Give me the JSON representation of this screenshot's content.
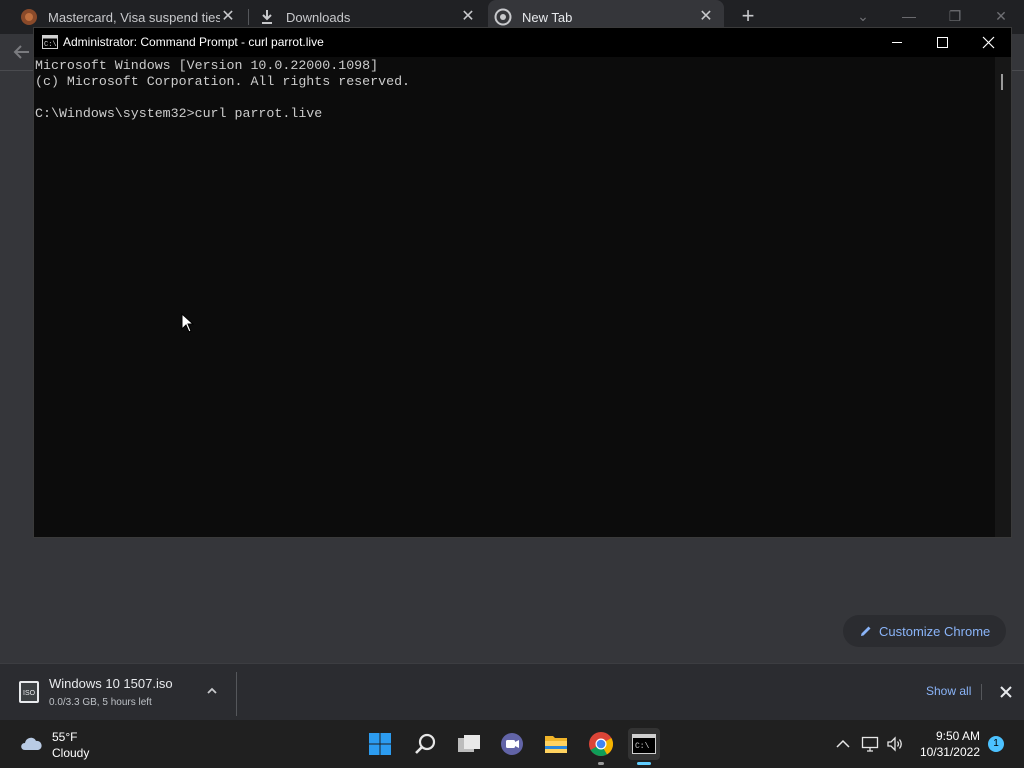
{
  "browser": {
    "tabs": [
      {
        "title": "Mastercard, Visa suspend ties wi",
        "favicon": "news-favicon",
        "active": false
      },
      {
        "title": "Downloads",
        "favicon": "download-icon",
        "active": false
      },
      {
        "title": "New Tab",
        "favicon": "chrome-icon",
        "active": true
      }
    ],
    "new_tab_label": "+",
    "customize_label": "Customize Chrome"
  },
  "cmd_window": {
    "title": "Administrator: Command Prompt - curl  parrot.live",
    "lines": [
      "Microsoft Windows [Version 10.0.22000.1098]",
      "(c) Microsoft Corporation. All rights reserved.",
      "",
      "C:\\Windows\\system32>curl parrot.live"
    ]
  },
  "download_shelf": {
    "file_name": "Windows 10 1507.iso",
    "status": "0.0/3.3 GB, 5 hours left",
    "show_all_label": "Show all"
  },
  "taskbar": {
    "weather": {
      "temp": "55°F",
      "condition": "Cloudy"
    },
    "apps": [
      "start-icon",
      "search-icon",
      "task-view-icon",
      "teams-chat-icon",
      "file-explorer-icon",
      "chrome-icon",
      "command-prompt-icon"
    ],
    "clock": {
      "time": "9:50 AM",
      "date": "10/31/2022"
    },
    "notification_count": "1"
  },
  "colors": {
    "accent": "#8ab4f8",
    "taskbar_accent": "#60cdff",
    "console_bg": "#0c0c0c",
    "console_text": "#cccccc"
  }
}
